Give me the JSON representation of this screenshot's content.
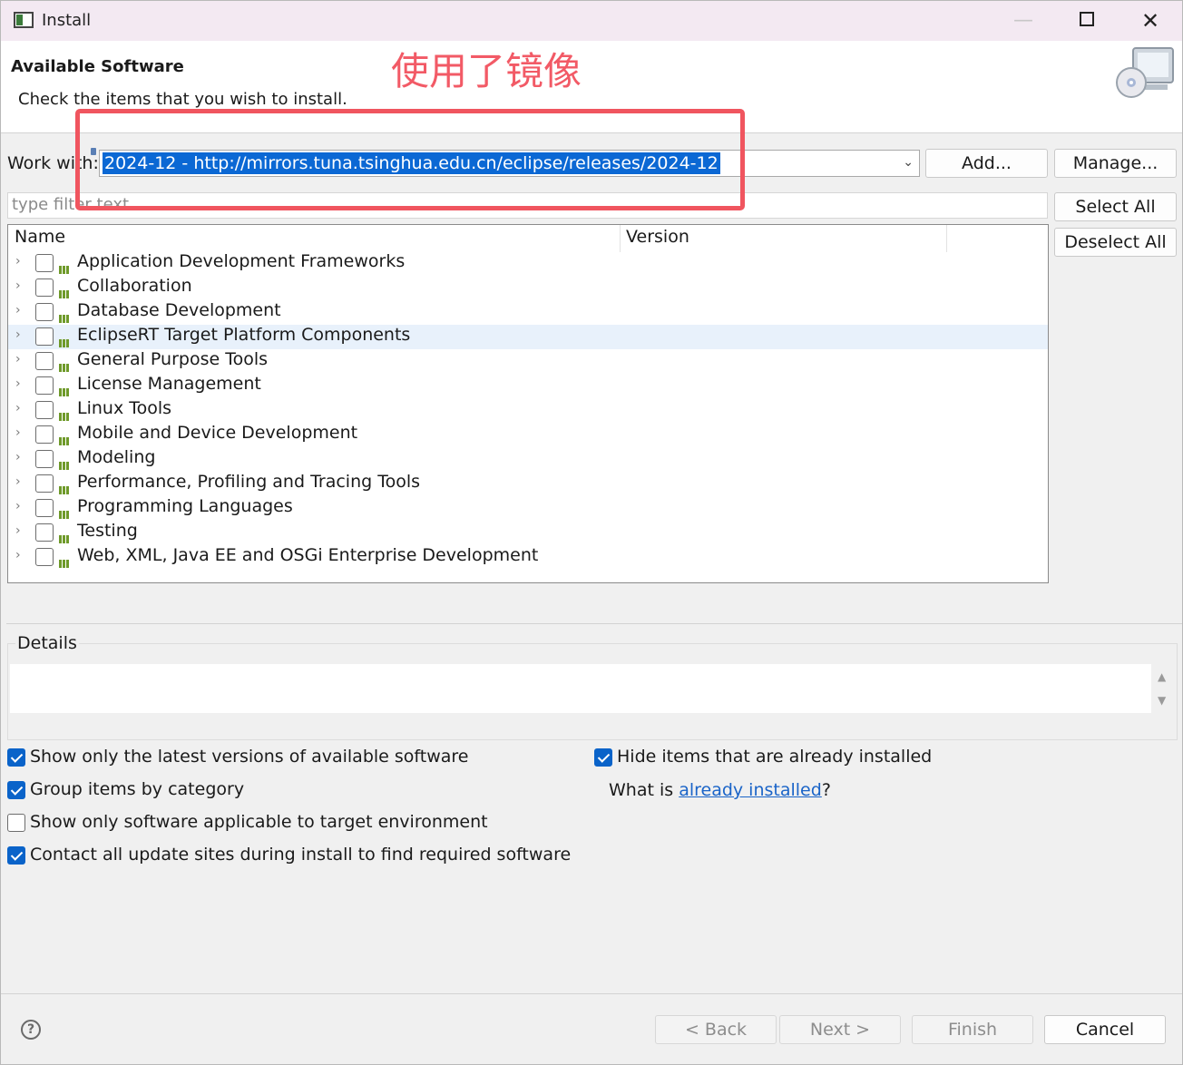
{
  "window": {
    "title": "Install",
    "minimize": "—",
    "close": "✕"
  },
  "header": {
    "title": "Available Software",
    "description": "Check the items that you wish to install.",
    "annotation": "使用了镜像"
  },
  "work_with": {
    "label": "Work with:",
    "value": "2024-12 - http://mirrors.tuna.tsinghua.edu.cn/eclipse/releases/2024-12",
    "add_label": "Add...",
    "manage_label": "Manage..."
  },
  "filter": {
    "placeholder": "type filter text"
  },
  "side_buttons": {
    "select_all": "Select All",
    "deselect_all": "Deselect All"
  },
  "tree": {
    "columns": [
      "Name",
      "Version"
    ],
    "items": [
      {
        "label": "Application Development Frameworks",
        "checked": false
      },
      {
        "label": "Collaboration",
        "checked": false
      },
      {
        "label": "Database Development",
        "checked": false
      },
      {
        "label": "EclipseRT Target Platform Components",
        "checked": false,
        "selected": true
      },
      {
        "label": "General Purpose Tools",
        "checked": false
      },
      {
        "label": "License Management",
        "checked": false
      },
      {
        "label": "Linux Tools",
        "checked": false
      },
      {
        "label": "Mobile and Device Development",
        "checked": false
      },
      {
        "label": "Modeling",
        "checked": false
      },
      {
        "label": "Performance, Profiling and Tracing Tools",
        "checked": false
      },
      {
        "label": "Programming Languages",
        "checked": false
      },
      {
        "label": "Testing",
        "checked": false
      },
      {
        "label": "Web, XML, Java EE and OSGi Enterprise Development",
        "checked": false
      }
    ]
  },
  "details": {
    "label": "Details",
    "text": ""
  },
  "options": {
    "latest_versions": {
      "label": "Show only the latest versions of available software",
      "checked": true
    },
    "group_by_category": {
      "label": "Group items by category",
      "checked": true
    },
    "applicable_only": {
      "label": "Show only software applicable to target environment",
      "checked": false
    },
    "contact_all_sites": {
      "label": "Contact all update sites during install to find required software",
      "checked": true
    },
    "hide_installed": {
      "label": "Hide items that are already installed",
      "checked": true
    },
    "what_is_prefix": "What is ",
    "already_installed_link": "already installed",
    "what_is_suffix": "?"
  },
  "footer": {
    "help": "?",
    "back_label": "< Back",
    "next_label": "Next >",
    "finish_label": "Finish",
    "cancel_label": "Cancel"
  },
  "colors": {
    "accent": "#0b68d4",
    "annotation": "#f25a66",
    "link": "#1a64c8",
    "selection_row": "#e8f1fb",
    "category_icon": "#6f9a2a"
  }
}
